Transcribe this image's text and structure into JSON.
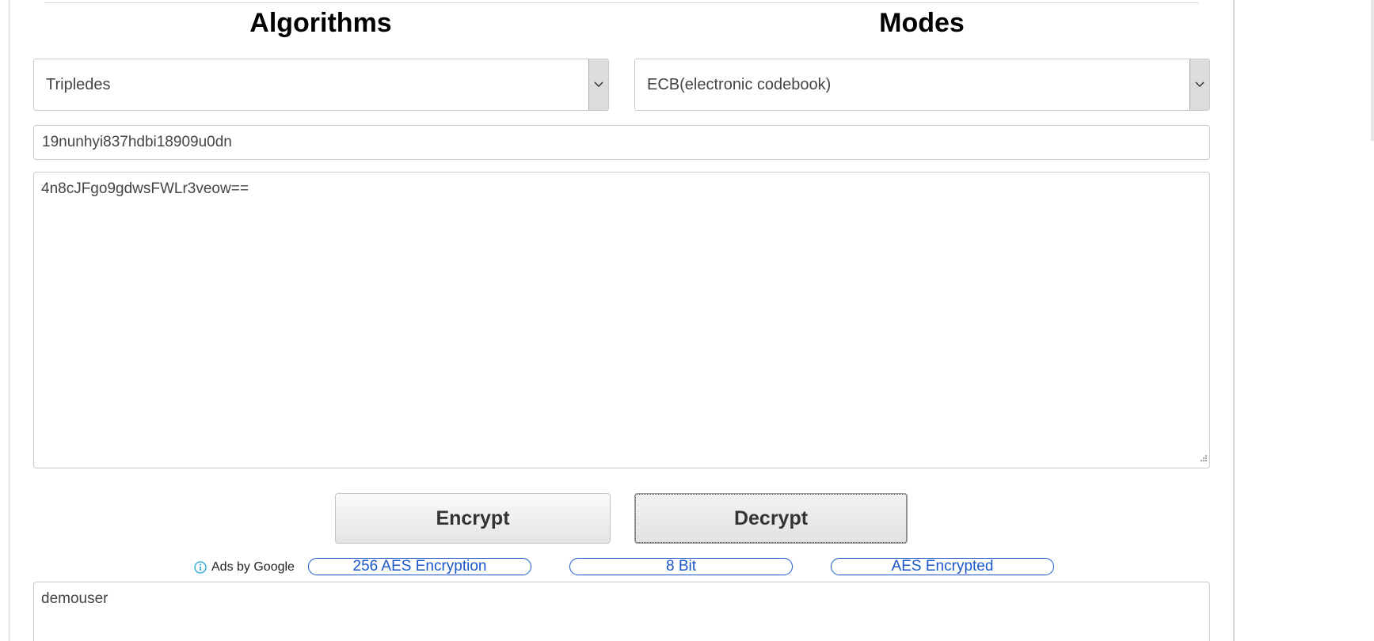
{
  "headings": {
    "algorithms": "Algorithms",
    "modes": "Modes"
  },
  "algorithm_select": {
    "selected": "Tripledes"
  },
  "mode_select": {
    "selected": "ECB(electronic codebook)"
  },
  "key_input": {
    "value": "19nunhyi837hdbi18909u0dn"
  },
  "input_text": {
    "value": "4n8cJFgo9gdwsFWLr3veow=="
  },
  "buttons": {
    "encrypt": "Encrypt",
    "decrypt": "Decrypt"
  },
  "ads": {
    "label": "Ads by Google",
    "links": [
      "256 AES Encryption",
      "8 Bit",
      "AES Encrypted"
    ]
  },
  "output_text": {
    "value": "demouser"
  },
  "icons": {
    "dropdown": "chevron-down-icon",
    "info": "info-icon",
    "resize": "resize-grip-icon"
  },
  "colors": {
    "ad_link": "#1a56c8",
    "info_icon": "#1aa3d6"
  }
}
